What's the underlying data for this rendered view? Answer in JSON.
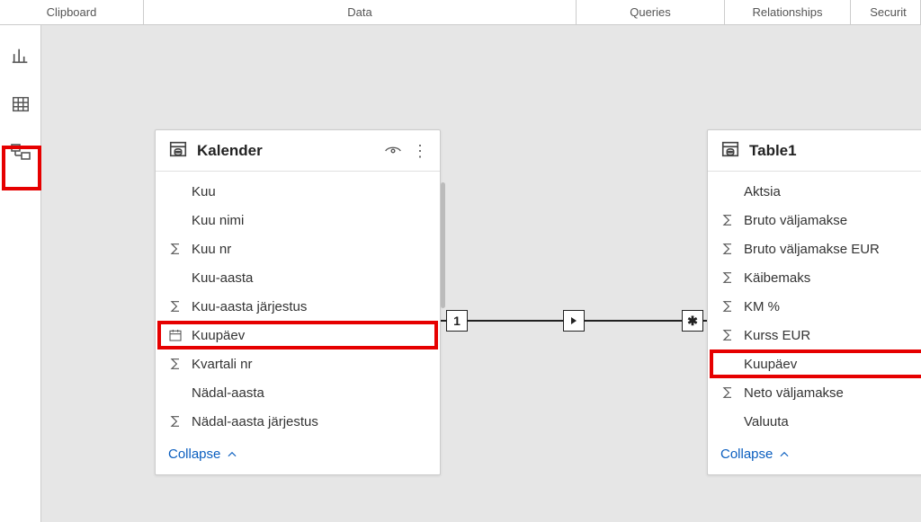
{
  "ribbon": {
    "clipboard": "Clipboard",
    "data": "Data",
    "queries": "Queries",
    "relationships": "Relationships",
    "security": "Securit"
  },
  "rail": {
    "report_icon": "report-icon",
    "data_icon": "data-grid-icon",
    "model_icon": "model-view-icon"
  },
  "collapse_label": "Collapse",
  "relationship": {
    "left_cardinality": "1",
    "right_cardinality": "✱",
    "direction": "▶"
  },
  "tables": {
    "kalender": {
      "title": "Kalender",
      "fields": [
        {
          "label": "Kuu",
          "icon": "",
          "highlight": false
        },
        {
          "label": "Kuu nimi",
          "icon": "",
          "highlight": false
        },
        {
          "label": "Kuu nr",
          "icon": "sigma",
          "highlight": false
        },
        {
          "label": "Kuu-aasta",
          "icon": "",
          "highlight": false
        },
        {
          "label": "Kuu-aasta järjestus",
          "icon": "sigma",
          "highlight": false
        },
        {
          "label": "Kuupäev",
          "icon": "date",
          "highlight": true
        },
        {
          "label": "Kvartali nr",
          "icon": "sigma",
          "highlight": false
        },
        {
          "label": "Nädal-aasta",
          "icon": "",
          "highlight": false
        },
        {
          "label": "Nädal-aasta järjestus",
          "icon": "sigma",
          "highlight": false
        }
      ]
    },
    "table1": {
      "title": "Table1",
      "fields": [
        {
          "label": "Aktsia",
          "icon": "",
          "highlight": false
        },
        {
          "label": "Bruto väljamakse",
          "icon": "sigma",
          "highlight": false
        },
        {
          "label": "Bruto väljamakse EUR",
          "icon": "sigma",
          "highlight": false
        },
        {
          "label": "Käibemaks",
          "icon": "sigma",
          "highlight": false
        },
        {
          "label": "KM %",
          "icon": "sigma",
          "highlight": false
        },
        {
          "label": "Kurss EUR",
          "icon": "sigma",
          "highlight": false
        },
        {
          "label": "Kuupäev",
          "icon": "",
          "highlight": true
        },
        {
          "label": "Neto väljamakse",
          "icon": "sigma",
          "highlight": false
        },
        {
          "label": "Valuuta",
          "icon": "",
          "highlight": false
        }
      ]
    }
  }
}
